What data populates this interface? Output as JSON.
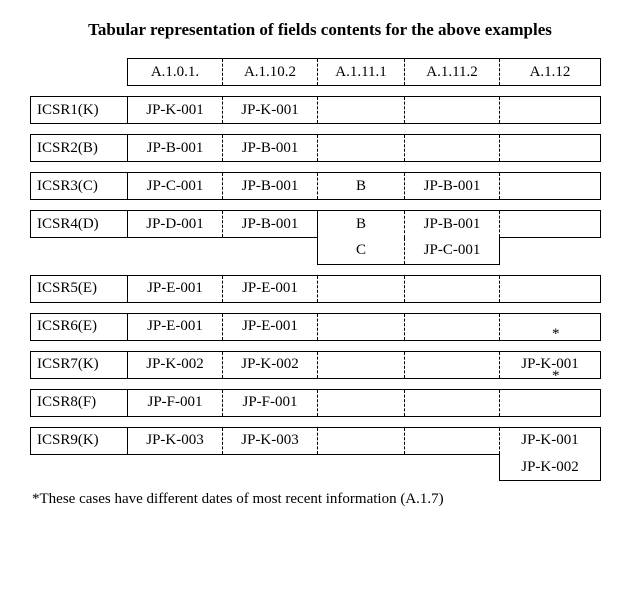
{
  "title": "Tabular representation of fields contents for the above examples",
  "headers": {
    "h1": "A.1.0.1.",
    "h2": "A.1.10.2",
    "h3": "A.1.11.1",
    "h4": "A.1.11.2",
    "h5": "A.1.12"
  },
  "rows": {
    "r1": {
      "label": "ICSR1(K)",
      "c1": "JP-K-001",
      "c2": "JP-K-001",
      "c3": "",
      "c4": "",
      "c5": ""
    },
    "r2": {
      "label": "ICSR2(B)",
      "c1": "JP-B-001",
      "c2": "JP-B-001",
      "c3": "",
      "c4": "",
      "c5": ""
    },
    "r3": {
      "label": "ICSR3(C)",
      "c1": "JP-C-001",
      "c2": "JP-B-001",
      "c3": "B",
      "c4": "JP-B-001",
      "c5": ""
    },
    "r4a": {
      "label": "ICSR4(D)",
      "c1": "JP-D-001",
      "c2": "JP-B-001",
      "c3": "B",
      "c4": "JP-B-001",
      "c5": ""
    },
    "r4b": {
      "c3": "C",
      "c4": "JP-C-001"
    },
    "r5": {
      "label": "ICSR5(E)",
      "c1": "JP-E-001",
      "c2": "JP-E-001",
      "c3": "",
      "c4": "",
      "c5": ""
    },
    "r6": {
      "label": "ICSR6(E)",
      "c1": "JP-E-001",
      "c2": "JP-E-001",
      "c3": "",
      "c4": "",
      "c5": ""
    },
    "r7": {
      "label": "ICSR7(K)",
      "c1": "JP-K-002",
      "c2": "JP-K-002",
      "c3": "",
      "c4": "",
      "c5": "JP-K-001"
    },
    "r8": {
      "label": "ICSR8(F)",
      "c1": "JP-F-001",
      "c2": "JP-F-001",
      "c3": "",
      "c4": "",
      "c5": ""
    },
    "r9a": {
      "label": "ICSR9(K)",
      "c1": "JP-K-003",
      "c2": "JP-K-003",
      "c3": "",
      "c4": "",
      "c5": "JP-K-001"
    },
    "r9b": {
      "c5": "JP-K-002"
    }
  },
  "star": "*",
  "footnote": "*These cases have different dates of most recent information (A.1.7)"
}
